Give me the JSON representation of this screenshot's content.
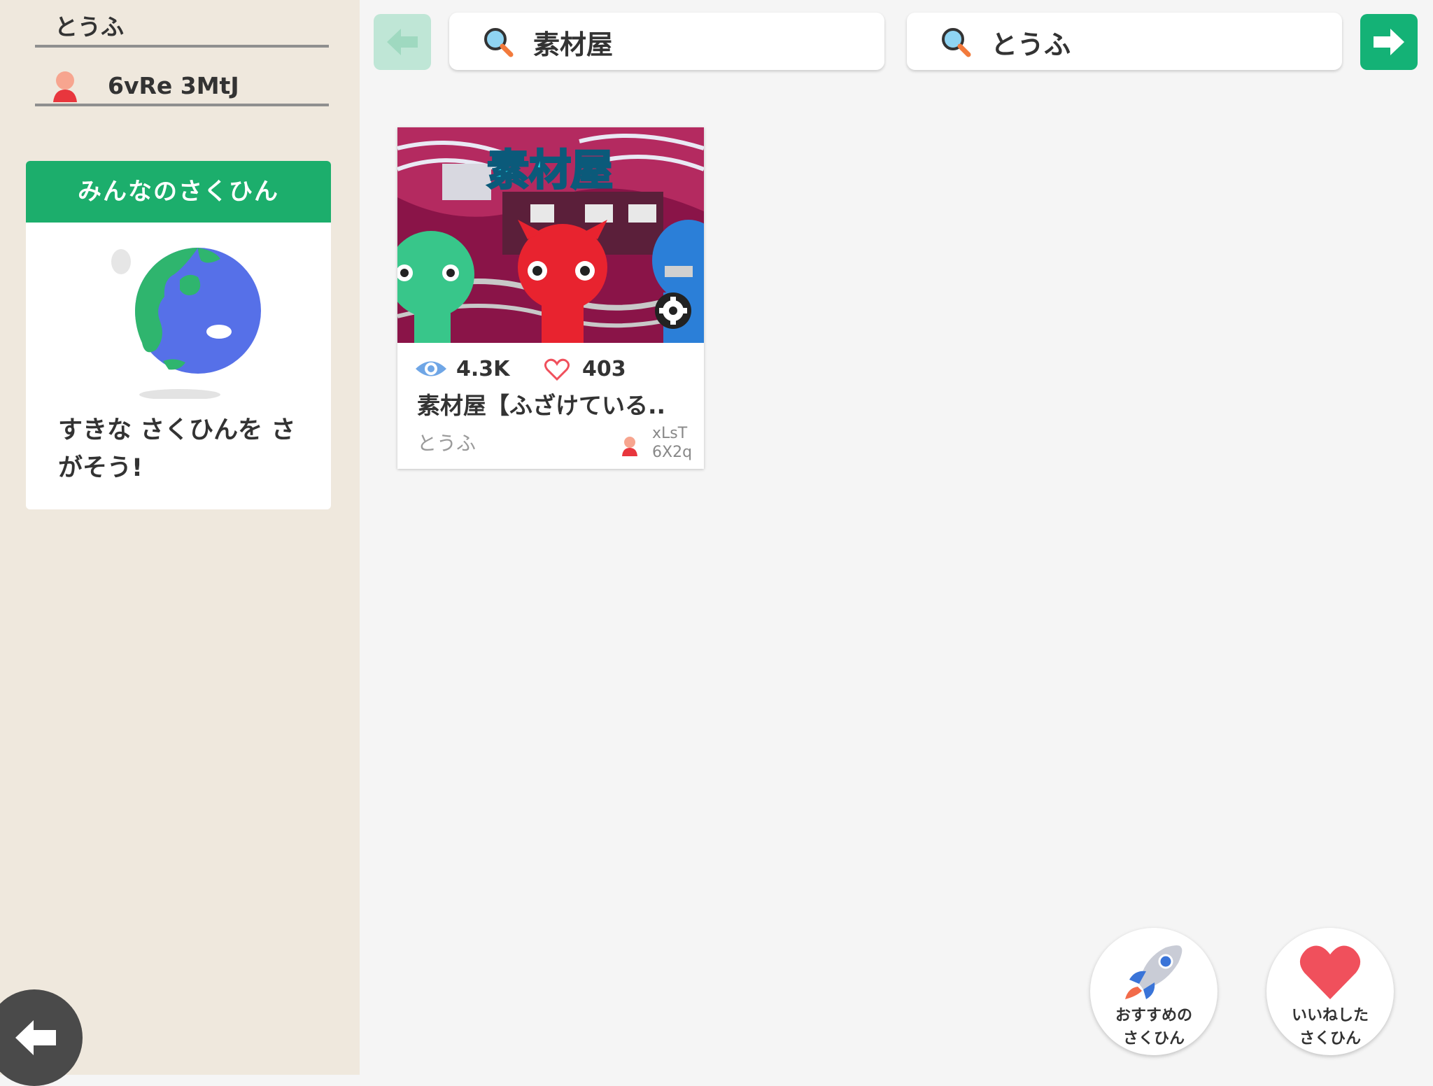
{
  "sidebar": {
    "keyword": "とうふ",
    "user_id": "6vRe 3MtJ",
    "panel": {
      "title": "みんなのさくひん",
      "message": "すきな さくひんを さがそう!"
    }
  },
  "topbar": {
    "search_title": "素材屋",
    "search_author": "とうふ"
  },
  "results": [
    {
      "thumb_text": "素材屋",
      "views": "4.3K",
      "likes": "403",
      "title": "素材屋【ふざけている..",
      "author": "とうふ",
      "user_id_line1": "xLsT",
      "user_id_line2": "6X2q"
    }
  ],
  "bottom": {
    "recommended_line1": "おすすめの",
    "recommended_line2": "さくひん",
    "liked_line1": "いいねした",
    "liked_line2": "さくひん"
  },
  "colors": {
    "accent_green": "#1cae6c",
    "sidebar_bg": "#efe8dd",
    "heart_red": "#f0505c"
  }
}
